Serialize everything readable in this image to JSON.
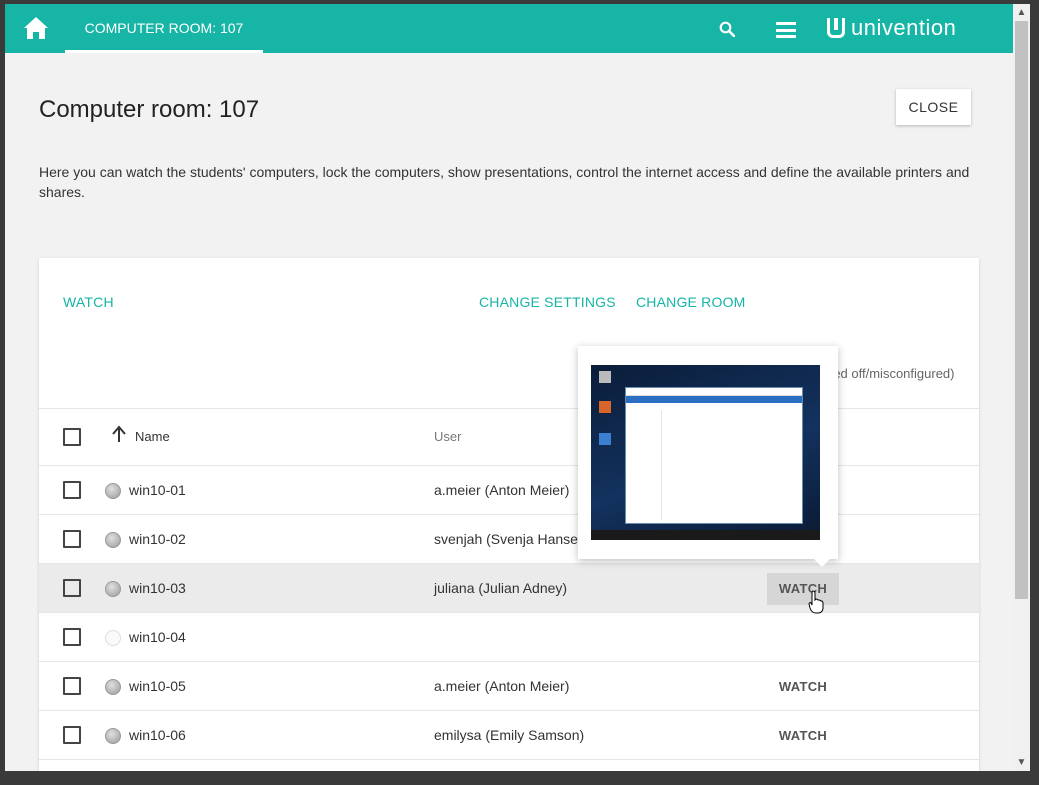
{
  "header": {
    "active_tab": "COMPUTER ROOM: 107",
    "brand": "univention",
    "color": "#16b5a6"
  },
  "page": {
    "title": "Computer room: 107",
    "close_label": "CLOSE",
    "description": "Here you can watch the students' computers, lock the computers, show presentations, control the internet access and define the available printers and shares."
  },
  "actions": {
    "watch": "WATCH",
    "change_settings": "CHANGE SETTINGS",
    "change_room": "CHANGE ROOM"
  },
  "status_note": "red off/misconfigured)",
  "table": {
    "columns": {
      "name": "Name",
      "user": "User"
    },
    "rows": [
      {
        "name": "win10-01",
        "user": "a.meier (Anton Meier)",
        "watch": "",
        "online": true
      },
      {
        "name": "win10-02",
        "user": "svenjah (Svenja Hansen)",
        "watch": "",
        "online": true
      },
      {
        "name": "win10-03",
        "user": "juliana (Julian Adney)",
        "watch": "WATCH",
        "online": true
      },
      {
        "name": "win10-04",
        "user": "",
        "watch": "",
        "online": false
      },
      {
        "name": "win10-05",
        "user": "a.meier (Anton Meier)",
        "watch": "WATCH",
        "online": true
      },
      {
        "name": "win10-06",
        "user": "emilysa (Emily Samson)",
        "watch": "WATCH",
        "online": true
      }
    ]
  }
}
